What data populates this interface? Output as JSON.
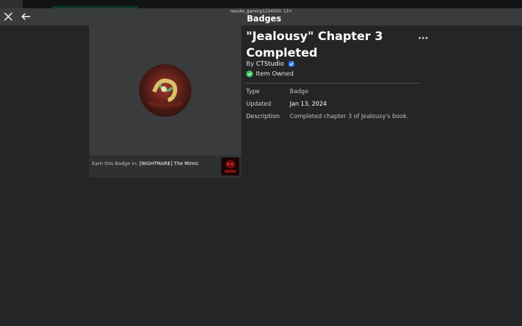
{
  "status_bar": {
    "text": "nezuko_gaming1234500: 13+"
  },
  "header": {
    "title": "Badges"
  },
  "badge": {
    "title": "\"Jealousy\" Chapter 3 Completed",
    "by_prefix": "By",
    "creator": "CTStudio",
    "owned_text": "Item Owned",
    "earn_prefix": "Earn this Badge in: ",
    "earn_game": "[NIGHTMARE] The Mimic",
    "details": {
      "type_label": "Type",
      "type_value": "Badge",
      "updated_label": "Updated",
      "updated_value": "Jan 13, 2024",
      "description_label": "Description",
      "description_value": "Completed chapter 3 of Jealousy's book."
    }
  },
  "colors": {
    "background": "#232527",
    "header": "#393b3d",
    "verified": "#3478f6",
    "owned": "#3fbb56"
  },
  "icons": {
    "close": "close-icon",
    "back": "back-arrow-icon",
    "more": "more-options-icon",
    "verified": "verified-badge-icon",
    "owned": "check-circle-icon"
  }
}
